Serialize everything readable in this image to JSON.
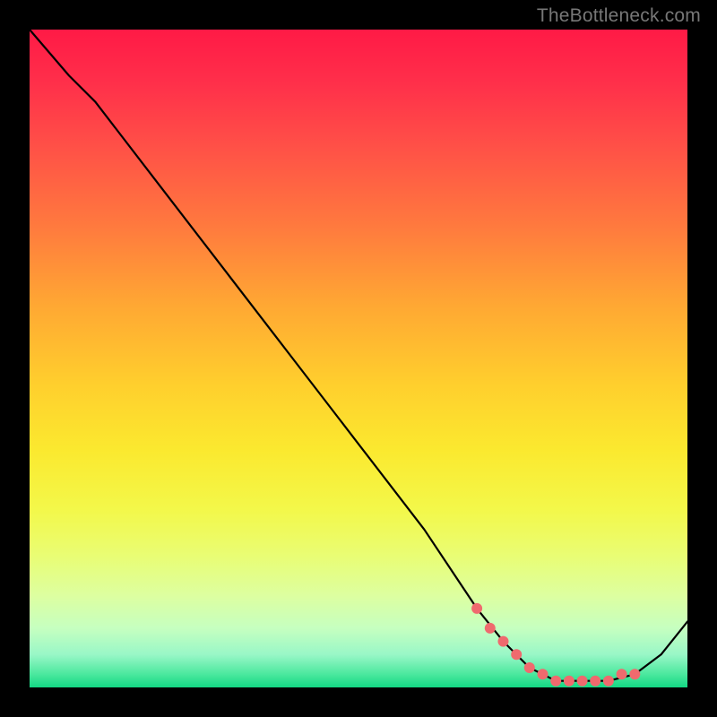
{
  "watermark": "TheBottleneck.com",
  "chart_data": {
    "type": "line",
    "title": "",
    "xlabel": "",
    "ylabel": "",
    "xlim": [
      0,
      100
    ],
    "ylim": [
      0,
      100
    ],
    "grid": false,
    "legend": false,
    "series": [
      {
        "name": "curve",
        "x": [
          0,
          6,
          10,
          20,
          30,
          40,
          50,
          60,
          68,
          72,
          76,
          80,
          84,
          88,
          92,
          96,
          100
        ],
        "values": [
          100,
          93,
          89,
          76,
          63,
          50,
          37,
          24,
          12,
          7,
          3,
          1,
          1,
          1,
          2,
          5,
          10
        ]
      }
    ],
    "highlight_points": {
      "name": "highlight",
      "color": "#ef6a6e",
      "x": [
        68,
        70,
        72,
        74,
        76,
        78,
        80,
        82,
        84,
        86,
        88,
        90,
        92
      ],
      "values": [
        12,
        9,
        7,
        5,
        3,
        2,
        1,
        1,
        1,
        1,
        1,
        2,
        2
      ]
    }
  }
}
